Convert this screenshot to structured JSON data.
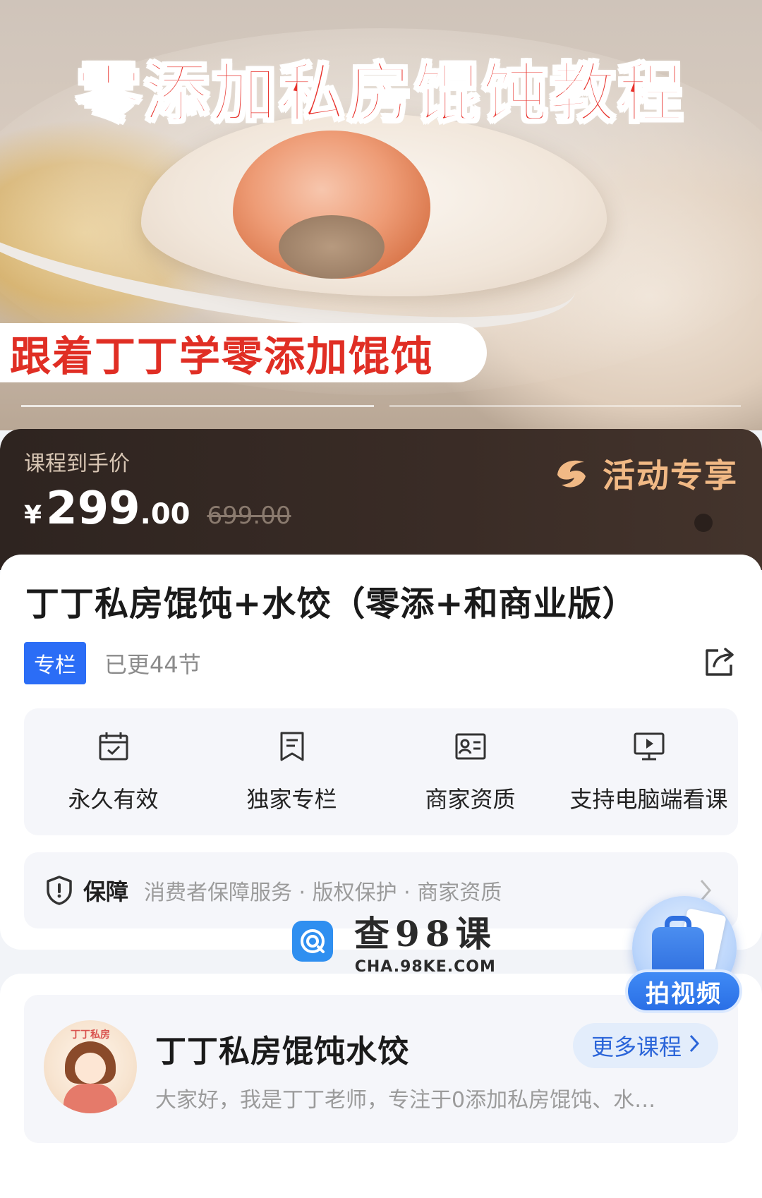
{
  "hero": {
    "title": "零添加私房馄饨教程",
    "subtitle": "跟着丁丁学零添加馄饨"
  },
  "price": {
    "label": "课程到手价",
    "currency": "¥",
    "integer": "299",
    "decimal": ".00",
    "original": "699.00",
    "activity": "活动专享"
  },
  "course": {
    "title": "丁丁私房馄饨+水饺（零添+和商业版）",
    "tag": "专栏",
    "updates": "已更44节"
  },
  "features": [
    {
      "label": "永久有效",
      "icon": "calendar-check-icon"
    },
    {
      "label": "独家专栏",
      "icon": "bookmark-icon"
    },
    {
      "label": "商家资质",
      "icon": "id-card-icon"
    },
    {
      "label": "支持电脑端看课",
      "icon": "monitor-play-icon"
    }
  ],
  "guarantee": {
    "title": "保障",
    "items": "消费者保障服务 · 版权保护 · 商家资质"
  },
  "watermark": {
    "title": "查98课",
    "url": "CHA.98KE.COM"
  },
  "float_button": {
    "label": "拍视频"
  },
  "teacher": {
    "avatar_text": "丁丁私房",
    "name": "丁丁私房馄饨水饺",
    "more_label": "更多课程",
    "description": "大家好，我是丁丁老师，专注于0添加私房馄饨、水…"
  },
  "colors": {
    "accent_blue": "#2b6df6",
    "hero_title_red": "#e8312b",
    "activity_orange": "#f1b985"
  }
}
